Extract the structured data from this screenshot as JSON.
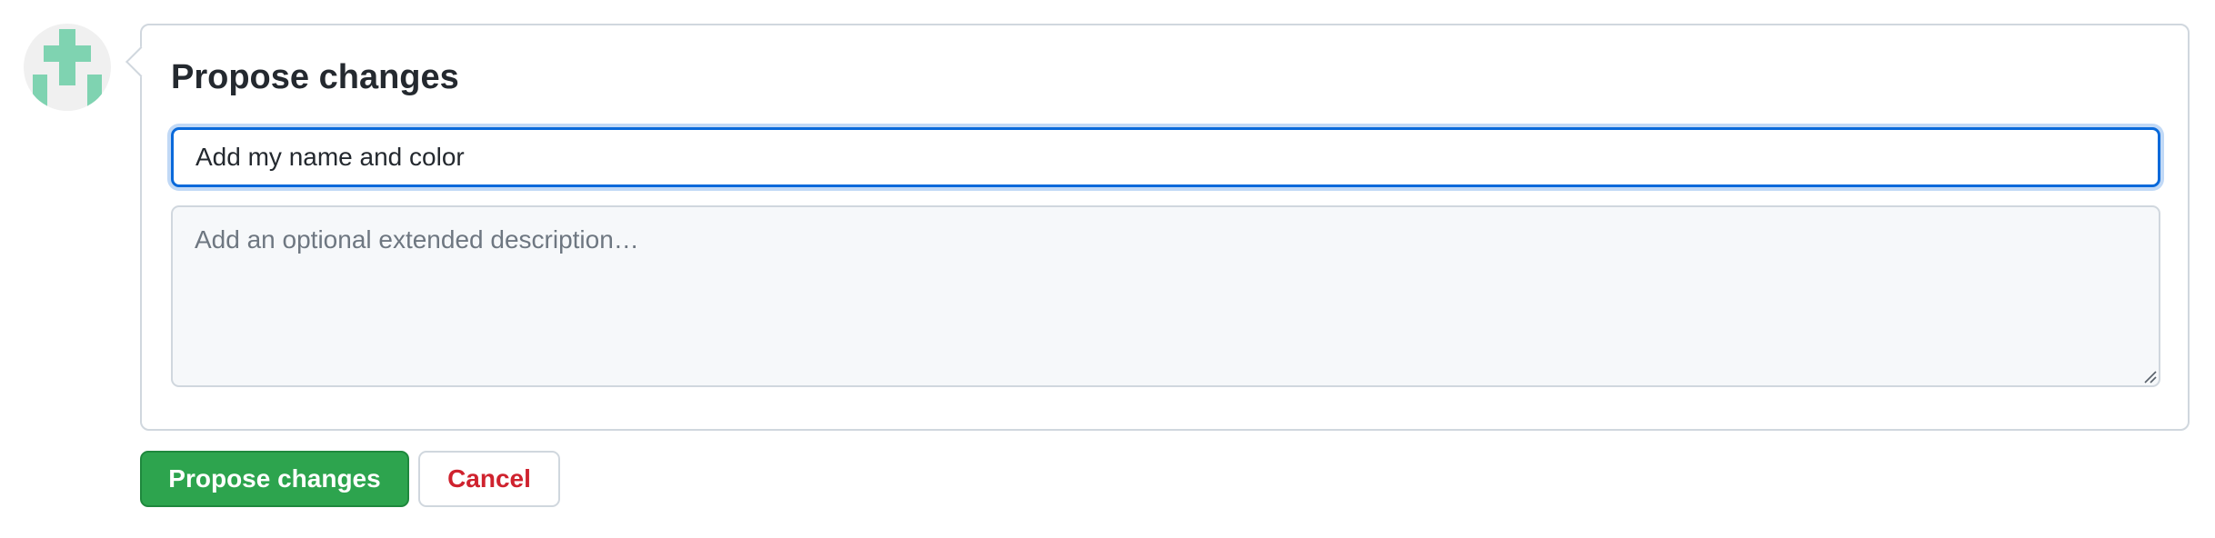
{
  "avatar": {
    "icon": "identicon",
    "background": "#f0f0f0",
    "color": "#7fd3b1"
  },
  "form": {
    "title": "Propose changes",
    "summary_value": "Add my name and color",
    "description_placeholder": "Add an optional extended description…"
  },
  "actions": {
    "submit_label": "Propose changes",
    "cancel_label": "Cancel"
  },
  "colors": {
    "primary": "#2da44e",
    "focus": "#0969da",
    "danger": "#cf222e"
  }
}
